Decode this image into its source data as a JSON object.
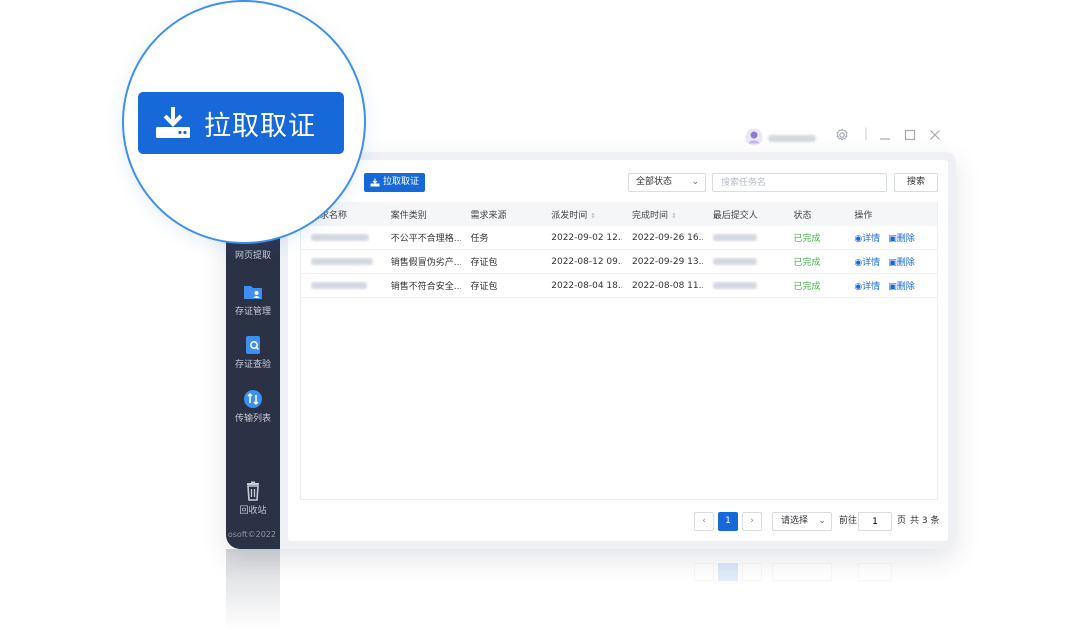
{
  "titlebar": {
    "user_name": "",
    "icons": [
      "avatar-icon",
      "gear-icon",
      "minimize-icon",
      "maximize-icon",
      "close-icon"
    ]
  },
  "sidebar": {
    "items": [
      {
        "label": "网页提取",
        "icon": "web-extract-icon"
      },
      {
        "label": "存证管理",
        "icon": "folder-user-icon"
      },
      {
        "label": "存证查验",
        "icon": "search-document-icon"
      },
      {
        "label": "传输列表",
        "icon": "transfer-icon"
      },
      {
        "label": "回收站",
        "icon": "trash-icon"
      }
    ],
    "copyright": "osoft©2022"
  },
  "toolbar": {
    "pull_button": "拉取取证",
    "status_select": "全部状态",
    "search_placeholder": "搜索任务名",
    "search_button": "搜索"
  },
  "table": {
    "columns": [
      "需求名称",
      "案件类别",
      "需求来源",
      "派发时间",
      "完成时间",
      "最后提交人",
      "状态",
      "操作"
    ],
    "rows": [
      {
        "name": "",
        "category": "不公平不合理格...",
        "source": "任务",
        "dispatch": "2022-09-02 12...",
        "complete": "2022-09-26 16...",
        "submitter": "",
        "status": "已完成"
      },
      {
        "name": "",
        "category": "销售假冒伪劣产...",
        "source": "存证包",
        "dispatch": "2022-08-12 09...",
        "complete": "2022-09-29 13...",
        "submitter": "",
        "status": "已完成"
      },
      {
        "name": "",
        "category": "销售不符合安全...",
        "source": "存证包",
        "dispatch": "2022-08-04 18...",
        "complete": "2022-08-08 11...",
        "submitter": "",
        "status": "已完成"
      }
    ],
    "actions": {
      "detail": "详情",
      "delete": "删除"
    }
  },
  "pagination": {
    "current_page": "1",
    "page_size_placeholder": "请选择",
    "goto_label": "前往",
    "goto_value": "1",
    "page_unit": "页",
    "total": "共 3 条"
  },
  "magnifier": {
    "button_label": "拉取取证"
  },
  "colors": {
    "primary": "#1768d8",
    "sidebar": "#2b3245",
    "success": "#45b24b",
    "cyan": "#35c2e6",
    "ring": "#3d8ff0"
  }
}
